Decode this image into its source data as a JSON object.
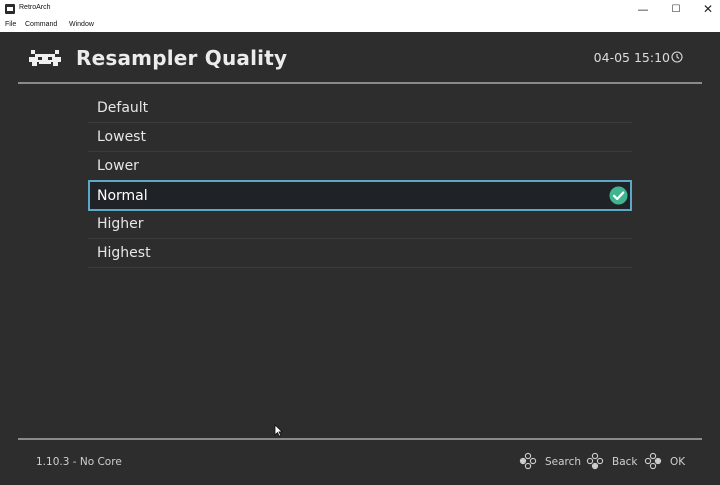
{
  "window": {
    "title": "RetroArch",
    "controls": {
      "minimize_icon": "minimize-icon",
      "maximize_icon": "maximize-icon",
      "close_icon": "close-icon"
    }
  },
  "menubar": {
    "items": [
      "File",
      "Command",
      "Window"
    ]
  },
  "header": {
    "logo_icon": "retroarch-invader-icon",
    "title": "Resampler Quality",
    "clock": "04-05 15:10",
    "clock_icon": "clock-icon"
  },
  "options": [
    {
      "label": "Default"
    },
    {
      "label": "Lowest"
    },
    {
      "label": "Lower"
    },
    {
      "label": "Normal",
      "selected": true,
      "icon": "checkmark-icon"
    },
    {
      "label": "Higher"
    },
    {
      "label": "Highest"
    }
  ],
  "footer": {
    "version": "1.10.3 - No Core",
    "actions": [
      {
        "label": "Search",
        "icon": "gamepad-button-icon"
      },
      {
        "label": "Back",
        "icon": "gamepad-button-icon"
      },
      {
        "label": "OK",
        "icon": "gamepad-button-icon"
      }
    ]
  },
  "colors": {
    "background": "#2d2d2d",
    "selection_border": "#5ba8c8",
    "check": "#3fb58f",
    "text": "#e6e6e6"
  }
}
